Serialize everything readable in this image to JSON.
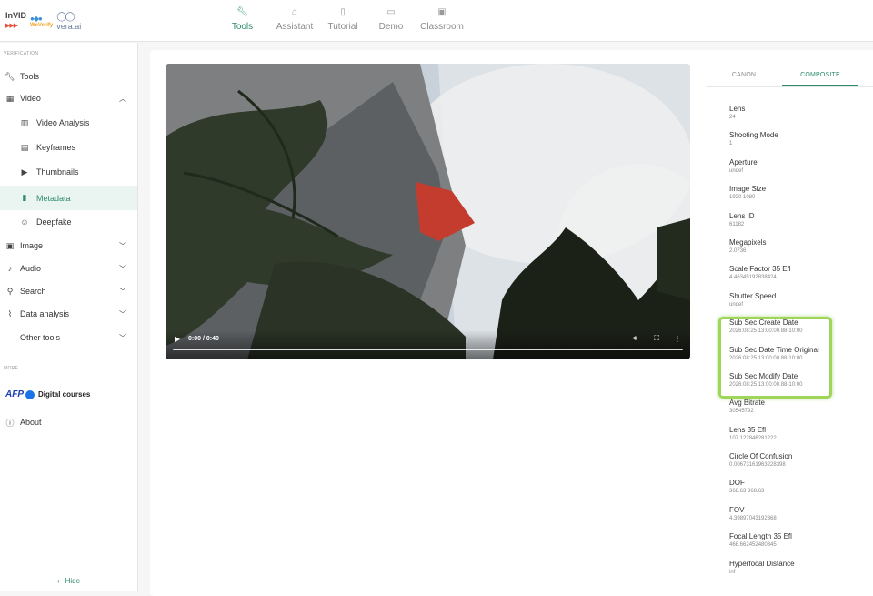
{
  "logo": {
    "invid": "InVID",
    "weverify": "WeVerify",
    "vera": "vera.ai"
  },
  "nav": [
    {
      "label": "Tools",
      "icon": "wrench-icon",
      "active": true
    },
    {
      "label": "Assistant",
      "icon": "robot-icon",
      "active": false
    },
    {
      "label": "Tutorial",
      "icon": "book-icon",
      "active": false
    },
    {
      "label": "Demo",
      "icon": "video-icon",
      "active": false
    },
    {
      "label": "Classroom",
      "icon": "classroom-icon",
      "active": false
    }
  ],
  "sidebar": {
    "section_verification": "VERIFICATION",
    "section_more": "MORE",
    "items": [
      {
        "label": "Tools",
        "icon": "wrench-icon"
      },
      {
        "label": "Video",
        "icon": "film-icon"
      },
      {
        "label": "Video Analysis",
        "icon": "film-strip-icon"
      },
      {
        "label": "Keyframes",
        "icon": "keyframes-icon"
      },
      {
        "label": "Thumbnails",
        "icon": "youtube-icon"
      },
      {
        "label": "Metadata",
        "icon": "document-icon"
      },
      {
        "label": "Deepfake",
        "icon": "face-icon"
      },
      {
        "label": "Image",
        "icon": "image-icon"
      },
      {
        "label": "Audio",
        "icon": "music-note-icon"
      },
      {
        "label": "Search",
        "icon": "search-icon"
      },
      {
        "label": "Data analysis",
        "icon": "chart-icon"
      },
      {
        "label": "Other tools",
        "icon": "more-horizontal-icon"
      }
    ],
    "afp": {
      "logo": "AFP",
      "label": "Digital courses"
    },
    "about": "About",
    "hide": "Hide"
  },
  "video": {
    "time": "0:00 / 0:40",
    "progress": 0
  },
  "meta_tabs": [
    "CANON",
    "COMPOSITE"
  ],
  "meta_items": [
    {
      "key": "Lens",
      "value": "24"
    },
    {
      "key": "Shooting Mode",
      "value": "1"
    },
    {
      "key": "Aperture",
      "value": "undef"
    },
    {
      "key": "Image Size",
      "value": "1920 1080"
    },
    {
      "key": "Lens ID",
      "value": "61182"
    },
    {
      "key": "Megapixels",
      "value": "2.0736"
    },
    {
      "key": "Scale Factor 35 Efl",
      "value": "4.46345192838424"
    },
    {
      "key": "Shutter Speed",
      "value": "undef"
    },
    {
      "key": "Sub Sec Create Date",
      "value": "2026:08:25 13:00:00.88-10:00"
    },
    {
      "key": "Sub Sec Date Time Original",
      "value": "2026:08:25 13:00:00.88-10:00"
    },
    {
      "key": "Sub Sec Modify Date",
      "value": "2026:08:25 13:00:00.88-10:00"
    },
    {
      "key": "Avg Bitrate",
      "value": "30545792"
    },
    {
      "key": "Lens 35 Efl",
      "value": "107.122846281222"
    },
    {
      "key": "Circle Of Confusion",
      "value": "0.00673161963228398"
    },
    {
      "key": "DOF",
      "value": "368.63 368.63"
    },
    {
      "key": "FOV",
      "value": "4.39897043192368"
    },
    {
      "key": "Focal Length 35 Efl",
      "value": "468.662452480345"
    },
    {
      "key": "Hyperfocal Distance",
      "value": "inf"
    }
  ],
  "colors": {
    "accent": "#2e8b6a",
    "highlight": "#9fd65a"
  }
}
